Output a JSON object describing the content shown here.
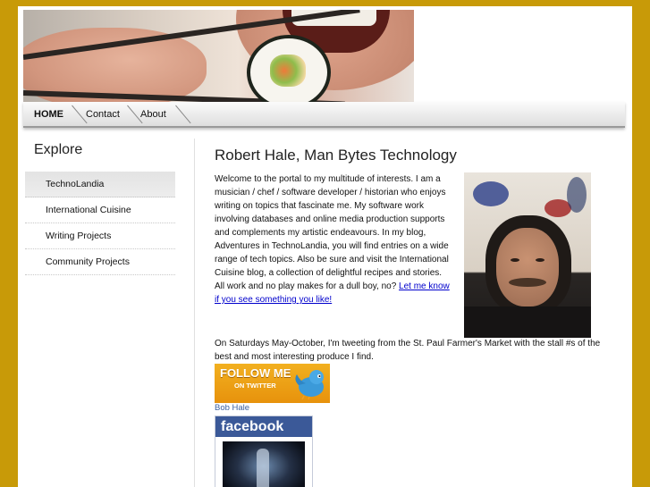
{
  "nav": {
    "items": [
      {
        "label": "HOME"
      },
      {
        "label": "Contact"
      },
      {
        "label": "About"
      }
    ]
  },
  "sidebar": {
    "title": "Explore",
    "items": [
      {
        "label": "TechnoLandia"
      },
      {
        "label": "International Cuisine"
      },
      {
        "label": "Writing Projects"
      },
      {
        "label": "Community Projects"
      }
    ]
  },
  "main": {
    "title": "Robert Hale, Man Bytes Technology",
    "intro_text": "Welcome to the portal to my multitude of interests. I am a musician / chef / software developer / historian who enjoys writing on topics that fascinate me. My software work involving databases and online media production supports and complements my artistic endeavours. In my blog, Adventures in TechnoLandia, you will find entries on a wide range of tech topics. Also be sure and visit the International Cuisine blog, a collection of delightful recipes and stories. All work and no play makes for a dull boy, no? ",
    "contact_link": "Let me know if you see something you like!",
    "market_text": "On Saturdays May-October, I'm tweeting from the St. Paul Farmer's Market with the stall #s of the best and most interesting produce I find.",
    "twitter_line1": "FOLLOW ME",
    "twitter_line2": "ON TWITTER",
    "bob_link": "Bob Hale",
    "facebook_label": "facebook"
  },
  "colors": {
    "page_background": "#c89a08",
    "link": "#0000cc",
    "facebook": "#3b5998"
  }
}
